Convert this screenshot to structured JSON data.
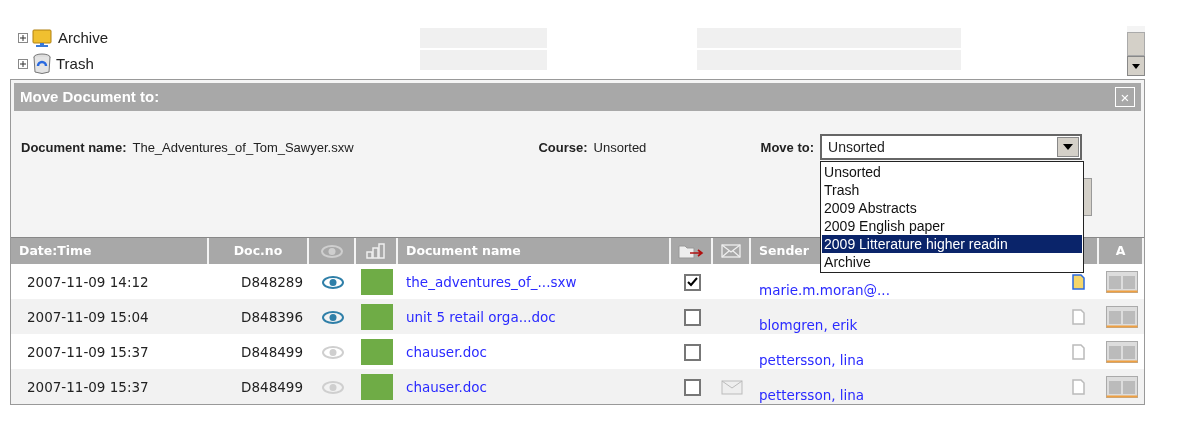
{
  "tree": [
    {
      "label": "Archive",
      "kind": "archive"
    },
    {
      "label": "Trash",
      "kind": "trash"
    }
  ],
  "dialog": {
    "title": "Move Document to:",
    "close": "×",
    "document_label": "Document name:",
    "document_name": "The_Adventures_of_Tom_Sawyer.sxw",
    "course_label": "Course:",
    "course": "Unsorted",
    "move_label": "Move to:",
    "move_value": "Unsorted",
    "options": [
      {
        "label": "Unsorted",
        "selected": false
      },
      {
        "label": "Trash",
        "selected": false
      },
      {
        "label": "2009 Abstracts",
        "selected": false
      },
      {
        "label": "2009 English paper",
        "selected": false
      },
      {
        "label": "2009 Litterature higher readin",
        "selected": true
      },
      {
        "label": "Archive",
        "selected": false
      }
    ]
  },
  "table": {
    "columns": [
      "Date:Time",
      "Doc.no",
      "",
      "",
      "Document name",
      "",
      "",
      "Sender",
      "",
      "A"
    ],
    "rows": [
      {
        "date": "2007-11-09 14:12",
        "doc_no": "D848289",
        "seen": true,
        "name": "the_adventures_of_...sxw",
        "checked": true,
        "mail": false,
        "sender": "marie.m.moran@...",
        "edit_active": true
      },
      {
        "date": "2007-11-09 15:04",
        "doc_no": "D848396",
        "seen": true,
        "name": "unit 5 retail orga...doc",
        "checked": false,
        "mail": false,
        "sender": "blomgren, erik",
        "edit_active": false
      },
      {
        "date": "2007-11-09 15:37",
        "doc_no": "D848499",
        "seen": false,
        "name": "chauser.doc",
        "checked": false,
        "mail": false,
        "sender": "pettersson, lina",
        "edit_active": false
      },
      {
        "date": "2007-11-09 15:37",
        "doc_no": "D848499",
        "seen": false,
        "name": "chauser.doc",
        "checked": false,
        "mail": true,
        "sender": "pettersson, lina",
        "edit_active": false
      }
    ]
  }
}
